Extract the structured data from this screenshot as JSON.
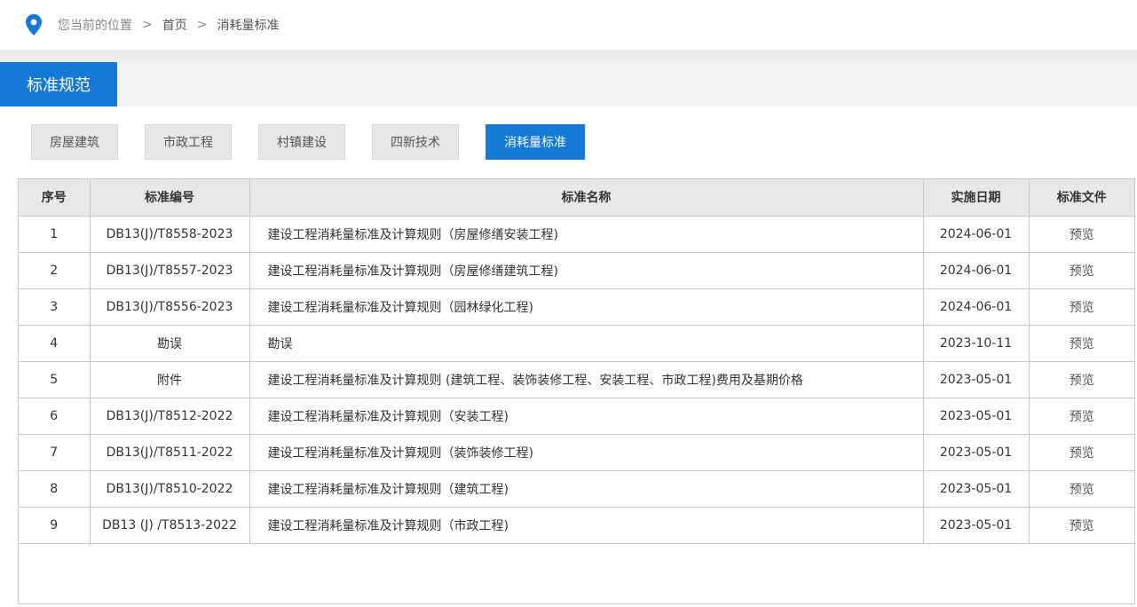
{
  "breadcrumb": {
    "prefix": "您当前的位置",
    "sep1": ">",
    "home": "首页",
    "sep2": ">",
    "current": "消耗量标准"
  },
  "section": {
    "title": "标准规范"
  },
  "tabs": [
    {
      "label": "房屋建筑"
    },
    {
      "label": "市政工程"
    },
    {
      "label": "村镇建设"
    },
    {
      "label": "四新技术"
    },
    {
      "label": "消耗量标准"
    }
  ],
  "active_tab": 4,
  "colors": {
    "accent": "#1479d7",
    "header_bg": "#e8e8e8",
    "tab_bg": "#e6e6e6"
  },
  "table": {
    "headers": {
      "no": "序号",
      "code": "标准编号",
      "name": "标准名称",
      "date": "实施日期",
      "file": "标准文件"
    },
    "rows": [
      {
        "no": "1",
        "code": "DB13(J)/T8558-2023",
        "name": "建设工程消耗量标准及计算规则（房屋修缮安装工程)",
        "date": "2024-06-01",
        "file": "预览"
      },
      {
        "no": "2",
        "code": "DB13(J)/T8557-2023",
        "name": "建设工程消耗量标准及计算规则（房屋修缮建筑工程)",
        "date": "2024-06-01",
        "file": "预览"
      },
      {
        "no": "3",
        "code": "DB13(J)/T8556-2023",
        "name": "建设工程消耗量标准及计算规则（园林绿化工程)",
        "date": "2024-06-01",
        "file": "预览"
      },
      {
        "no": "4",
        "code": "勘误",
        "name": "勘误",
        "date": "2023-10-11",
        "file": "预览"
      },
      {
        "no": "5",
        "code": "附件",
        "name": "建设工程消耗量标准及计算规则 (建筑工程、装饰装修工程、安装工程、市政工程)费用及基期价格",
        "date": "2023-05-01",
        "file": "预览"
      },
      {
        "no": "6",
        "code": "DB13(J)/T8512-2022",
        "name": "建设工程消耗量标准及计算规则（安装工程)",
        "date": "2023-05-01",
        "file": "预览"
      },
      {
        "no": "7",
        "code": "DB13(J)/T8511-2022",
        "name": "建设工程消耗量标准及计算规则（装饰装修工程)",
        "date": "2023-05-01",
        "file": "预览"
      },
      {
        "no": "8",
        "code": "DB13(J)/T8510-2022",
        "name": "建设工程消耗量标准及计算规则（建筑工程)",
        "date": "2023-05-01",
        "file": "预览"
      },
      {
        "no": "9",
        "code": "DB13 (J) /T8513-2022",
        "name": "建设工程消耗量标准及计算规则（市政工程)",
        "date": "2023-05-01",
        "file": "预览"
      }
    ]
  }
}
